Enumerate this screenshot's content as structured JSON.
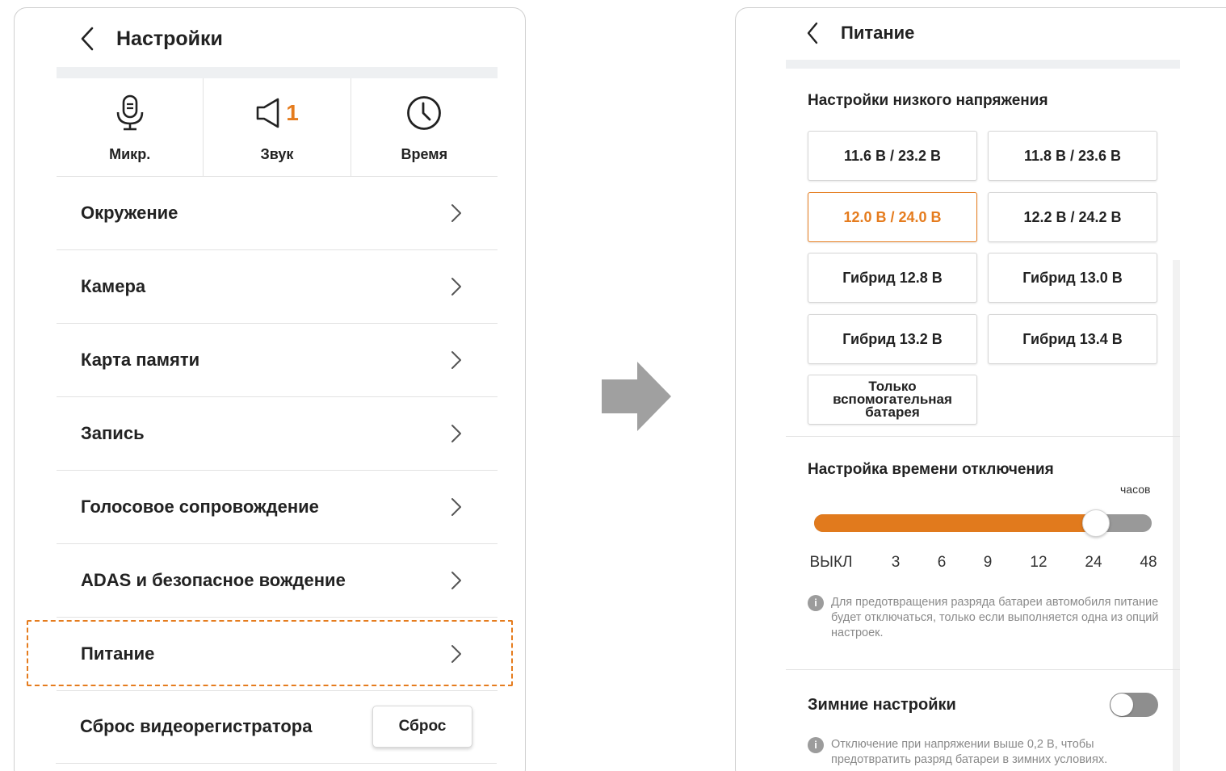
{
  "settings_screen": {
    "title": "Настройки",
    "quick_actions": [
      {
        "label": "Микр.",
        "icon": "microphone-icon"
      },
      {
        "label": "Звук",
        "icon": "speaker-icon",
        "value": "1"
      },
      {
        "label": "Время",
        "icon": "clock-icon"
      }
    ],
    "menu_items": [
      {
        "label": "Окружение"
      },
      {
        "label": "Камера"
      },
      {
        "label": "Карта памяти"
      },
      {
        "label": "Запись"
      },
      {
        "label": "Голосовое сопровождение"
      },
      {
        "label": "ADAS и безопасное вождение"
      },
      {
        "label": "Питание",
        "highlighted": true
      }
    ],
    "reset_row": {
      "label": "Сброс видеорегистратора",
      "button_label": "Сброс"
    }
  },
  "power_screen": {
    "title": "Питание",
    "low_voltage": {
      "title": "Настройки низкого напряжения",
      "options": [
        "11.6 В / 23.2 В",
        "11.8 В / 23.6 В",
        "12.0 В / 24.0 В",
        "12.2 В / 24.2 В",
        "Гибрид 12.8 В",
        "Гибрид 13.0 В",
        "Гибрид 13.2 В",
        "Гибрид 13.4 В",
        "Только вспомогательная батарея"
      ],
      "selected": "12.0 В / 24.0 В"
    },
    "shutdown_timer": {
      "title": "Настройка времени отключения",
      "unit": "часов",
      "ticks": [
        "ВЫКЛ",
        "3",
        "6",
        "9",
        "12",
        "24",
        "48"
      ],
      "selected": "24",
      "note": "Для предотвращения разряда батареи автомобиля питание будет отключаться, только если выполняется одна из опций настроек."
    },
    "winter": {
      "label": "Зимние настройки",
      "enabled": false,
      "note": "Отключение при напряжении выше 0,2 В, чтобы предотвратить разряд батареи в зимних условиях."
    }
  },
  "colors": {
    "accent": "#e57c1e",
    "text": "#222222",
    "muted": "#8a8a8a",
    "divider": "#e2e2e2",
    "arrow": "#a0a0a0"
  }
}
